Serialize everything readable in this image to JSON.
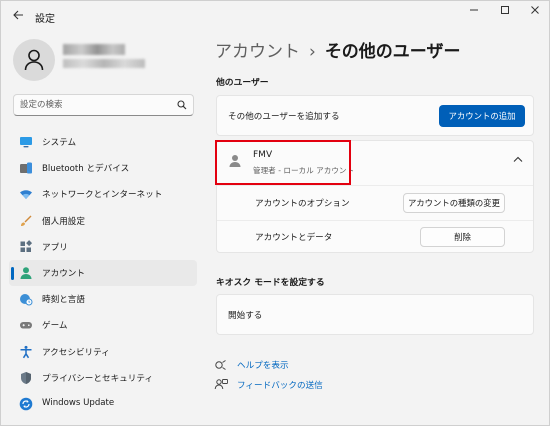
{
  "app": {
    "title": "設定"
  },
  "search": {
    "placeholder": "設定の検索"
  },
  "sidebar": {
    "items": [
      {
        "label": "システム",
        "icon": "monitor-icon"
      },
      {
        "label": "Bluetooth とデバイス",
        "icon": "bluetooth-devices-icon"
      },
      {
        "label": "ネットワークとインターネット",
        "icon": "wifi-icon"
      },
      {
        "label": "個人用設定",
        "icon": "brush-icon"
      },
      {
        "label": "アプリ",
        "icon": "apps-icon"
      },
      {
        "label": "アカウント",
        "icon": "account-icon",
        "active": true
      },
      {
        "label": "時刻と言語",
        "icon": "globe-clock-icon"
      },
      {
        "label": "ゲーム",
        "icon": "gamepad-icon"
      },
      {
        "label": "アクセシビリティ",
        "icon": "accessibility-icon"
      },
      {
        "label": "プライバシーとセキュリティ",
        "icon": "shield-icon"
      },
      {
        "label": "Windows Update",
        "icon": "windows-update-icon"
      }
    ]
  },
  "header": {
    "parent": "アカウント",
    "separator": "›",
    "current": "その他のユーザー"
  },
  "other_users": {
    "section_title": "他のユーザー",
    "add_label": "その他のユーザーを追加する",
    "add_button": "アカウントの追加",
    "user": {
      "name": "FMV",
      "subtitle": "管理者 - ローカル アカウント",
      "options_label": "アカウントのオプション",
      "change_type_button": "アカウントの種類の変更",
      "data_label": "アカウントとデータ",
      "delete_button": "削除"
    }
  },
  "kiosk": {
    "section_title": "キオスク モードを設定する",
    "start_label": "開始する"
  },
  "links": {
    "help": "ヘルプを表示",
    "feedback": "フィードバックの送信"
  },
  "colors": {
    "accent": "#005fb8",
    "link": "#0067c0",
    "highlight": "#e3000f"
  }
}
